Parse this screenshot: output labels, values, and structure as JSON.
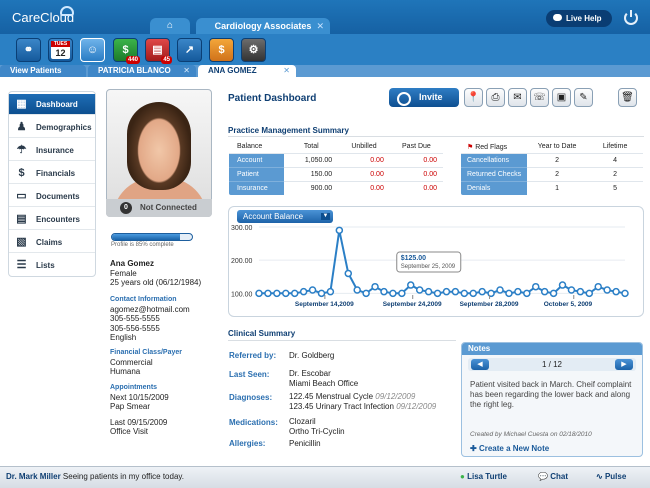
{
  "app": {
    "logo": "CareCloud"
  },
  "header": {
    "tab_title": "Cardiology Associates",
    "tab_close": "✕",
    "home_icon": "⌂",
    "live_help": "Live Help"
  },
  "toolbar": {
    "calendar_day": "TUES",
    "calendar_date": "12",
    "billing_badge": "440",
    "claims_badge": "45"
  },
  "subtabs": [
    {
      "label": "View Patients"
    },
    {
      "label": "PATRICIA BLANCO",
      "close": "✕"
    },
    {
      "label": "ANA GOMEZ",
      "close": "✕"
    }
  ],
  "sidebar": {
    "items": [
      {
        "label": "Dashboard",
        "icon": "grid-icon"
      },
      {
        "label": "Demographics",
        "icon": "person-icon"
      },
      {
        "label": "Insurance",
        "icon": "umbrella-icon"
      },
      {
        "label": "Financials",
        "icon": "dollar-icon"
      },
      {
        "label": "Documents",
        "icon": "document-icon"
      },
      {
        "label": "Encounters",
        "icon": "clipboard-icon"
      },
      {
        "label": "Claims",
        "icon": "claims-icon"
      },
      {
        "label": "Lists",
        "icon": "list-icon"
      }
    ]
  },
  "patient": {
    "connection_count": "0",
    "connection_status": "Not Connected",
    "profile_complete": 0.85,
    "profile_text": "Profile is 85% complete",
    "name": "Ana Gomez",
    "gender": "Female",
    "age_dob": "25 years old (06/12/1984)",
    "contact_label": "Contact Information",
    "email": "agomez@hotmail.com",
    "phone1": "305-555-5555",
    "phone2": "305-556-5555",
    "language": "English",
    "class_label": "Financial Class/Payer",
    "class": "Commercial",
    "payer": "Humana",
    "appt_label": "Appointments",
    "next_appt": "Next 10/15/2009",
    "next_type": "Pap Smear",
    "last_appt": "Last 09/15/2009",
    "last_type": "Office Visit"
  },
  "dashboard": {
    "title": "Patient Dashboard",
    "invite": "Invite",
    "pm_title": "Practice Management Summary",
    "pm_headers": [
      "Balance",
      "Total",
      "Unbilled",
      "Past Due"
    ],
    "pm_rows": [
      {
        "label": "Account",
        "total": "1,050.00",
        "unbilled": "0.00",
        "past_due": "0.00"
      },
      {
        "label": "Patient",
        "total": "150.00",
        "unbilled": "0.00",
        "past_due": "0.00"
      },
      {
        "label": "Insurance",
        "total": "900.00",
        "unbilled": "0.00",
        "past_due": "0.00"
      }
    ],
    "rf_headers": [
      "Red Flags",
      "Year to Date",
      "Lifetime"
    ],
    "rf_rows": [
      {
        "label": "Cancellations",
        "ytd": "2",
        "life": "4"
      },
      {
        "label": "Returned Checks",
        "ytd": "2",
        "life": "2"
      },
      {
        "label": "Denials",
        "ytd": "1",
        "life": "5"
      }
    ],
    "chart_select": "Account Balance"
  },
  "chart_data": {
    "type": "line",
    "series": [
      {
        "values": [
          100,
          100,
          100,
          100,
          100,
          105,
          110,
          100,
          105,
          290,
          160,
          110,
          100,
          120,
          105,
          100,
          100,
          125,
          110,
          105,
          100,
          105,
          105,
          100,
          100,
          105,
          100,
          110,
          100,
          105,
          100,
          120,
          105,
          100,
          125,
          110,
          105,
          100,
          120,
          110,
          105,
          100
        ]
      }
    ],
    "y_ticks": [
      "300.00",
      "200.00",
      "100.00"
    ],
    "ylim": [
      95,
      300
    ],
    "x_labels": [
      "September 14,2009",
      "September 24,2009",
      "September 28,2009",
      "October 5, 2009"
    ],
    "tooltip_value": "$125.00",
    "tooltip_date": "September 25, 2009"
  },
  "clinical": {
    "title": "Clinical Summary",
    "referred_label": "Referred by:",
    "referred": "Dr. Goldberg",
    "seen_label": "Last Seen:",
    "seen_doctor": "Dr. Escobar",
    "seen_place": "Miami Beach Office",
    "dx_label": "Diagnoses:",
    "dx1": "122.45 Menstrual Cycle",
    "dx1_date": "09/12/2009",
    "dx2": "123.45 Urinary Tract Infection",
    "dx2_date": "09/12/2009",
    "meds_label": "Medications:",
    "med1": "Clozaril",
    "med2": "Ortho Tri-Cyclin",
    "allergy_label": "Allergies:",
    "allergy": "Penicillin"
  },
  "notes": {
    "title": "Notes",
    "page": "1 / 12",
    "text": "Patient visited back in March. Cheif complaint has been regarding the lower back and along the right leg.",
    "meta": "Created by Michael Cuesta on 02/18/2010",
    "create": "Create a New Note"
  },
  "footer": {
    "doctor": "Dr. Mark Miller",
    "status": "Seeing patients in my office today.",
    "user": "Lisa Turtle",
    "chat": "Chat",
    "pulse": "Pulse"
  }
}
